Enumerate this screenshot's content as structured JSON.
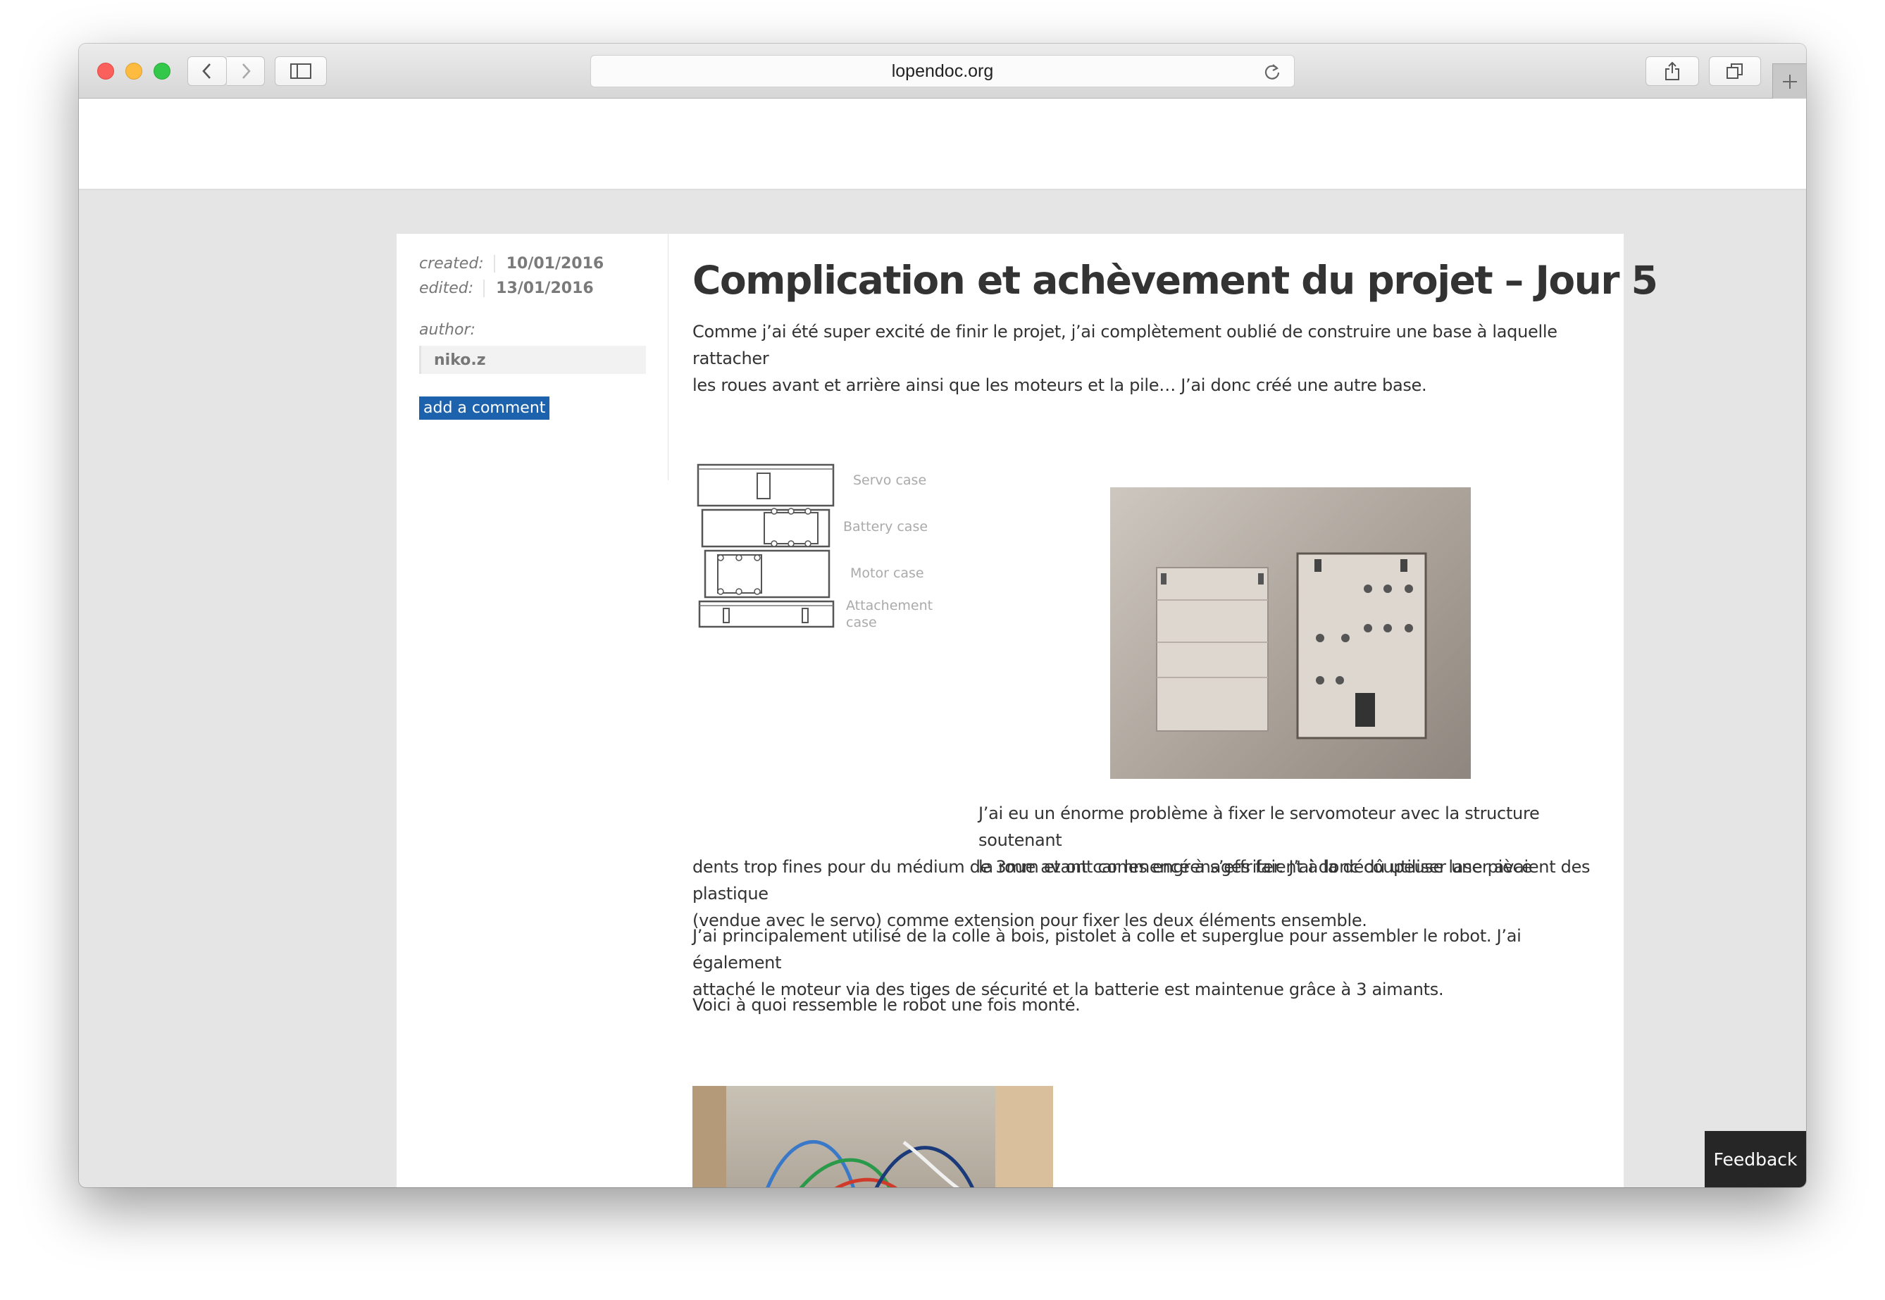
{
  "browser": {
    "url": "lopendoc.org"
  },
  "meta": {
    "created_label": "created:",
    "created_value": "10/01/2016",
    "edited_label": "edited:",
    "edited_value": "13/01/2016",
    "author_label": "author:",
    "author_value": "niko.z",
    "add_comment": "add a comment"
  },
  "post": {
    "title": "Complication et achèvement du projet – Jour 5",
    "intro_line1": "Comme j’ai été super excité de finir le projet, j’ai complètement oublié de construire une base à laquelle rattacher",
    "intro_line2": "les roues avant et arrière ainsi que les moteurs et la pile… J’ai donc créé une autre base.",
    "problem_line1": "J’ai eu un énorme problème à fixer le servomoteur avec la structure soutenant",
    "problem_line2": "la roue avant car les engrenages faient à la découpeuse laser avaient des",
    "problem_line3": "dents trop fines pour du médium de 3mm et ont commencé à s’effriter. J’ai donc dû utiliser une pièce plastique",
    "problem_line4": "(vendue avec le servo) comme extension pour fixer les deux éléments ensemble.",
    "assembly_line1": "J’ai principalement utilisé de la colle à bois, pistolet à colle et superglue pour assembler le robot. J’ai également",
    "assembly_line2": "attaché le moteur via des tiges de sécurité et la batterie est maintenue grâce à 3 aimants.",
    "final_line": "Voici à quoi ressemble le robot une fois monté."
  },
  "diagram": {
    "labels": [
      "Servo case",
      "Battery case",
      "Motor case",
      "Attachement",
      "case"
    ]
  },
  "feedback": "Feedback"
}
